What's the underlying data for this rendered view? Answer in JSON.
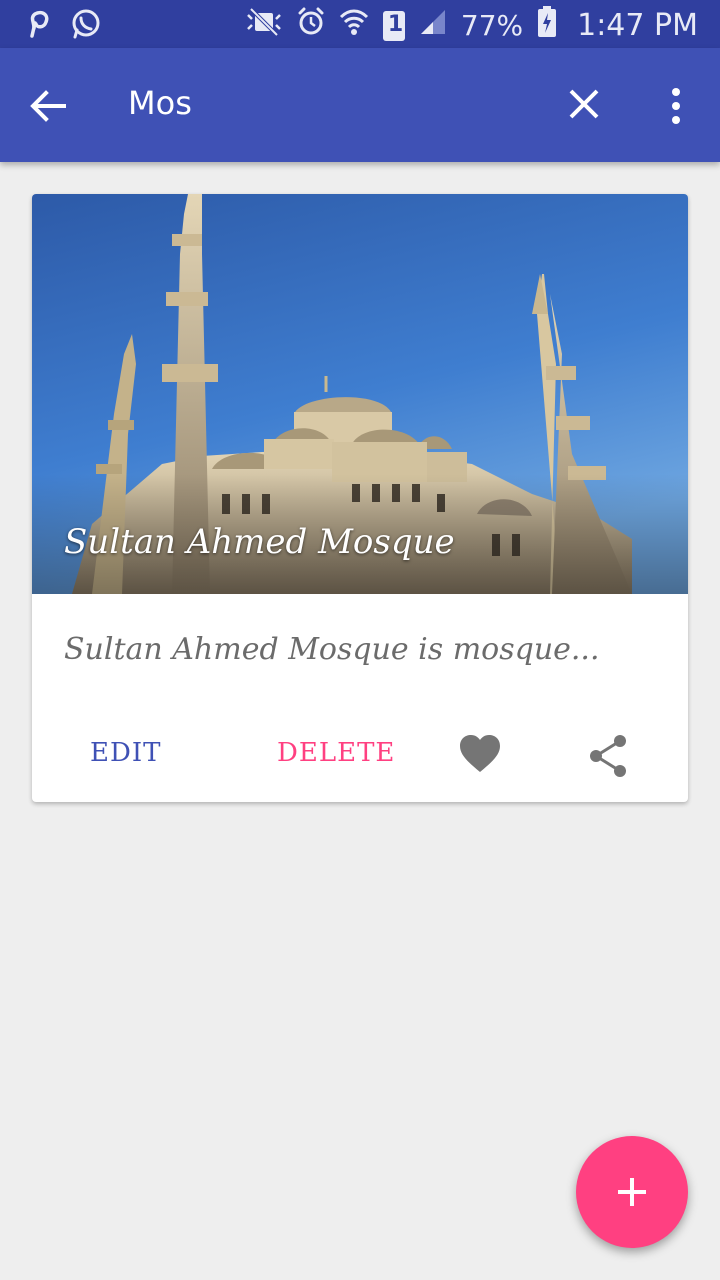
{
  "status_bar": {
    "battery_percent": "77%",
    "time": "1:47 PM",
    "sim_slot": "1",
    "icons": [
      "pinterest-icon",
      "whatsapp-icon",
      "mute-icon",
      "alarm-icon",
      "wifi-icon",
      "sim-icon",
      "signal-icon",
      "battery-icon"
    ]
  },
  "app_bar": {
    "search_query": "Mos",
    "background_color": "#3f51b5",
    "icons": [
      "back-arrow-icon",
      "close-icon",
      "overflow-menu-icon"
    ]
  },
  "card": {
    "title": "Sultan Ahmed Mosque",
    "description": "Sultan Ahmed Mosque is mosque...",
    "edit_label": "EDIT",
    "delete_label": "DELETE",
    "icons": [
      "heart-icon",
      "share-icon"
    ]
  },
  "fab": {
    "icon": "add-icon",
    "color": "#ff4081"
  },
  "colors": {
    "primary": "#3f51b5",
    "primary_dark": "#303f9f",
    "accent": "#ff4081",
    "background": "#eeeeee"
  }
}
